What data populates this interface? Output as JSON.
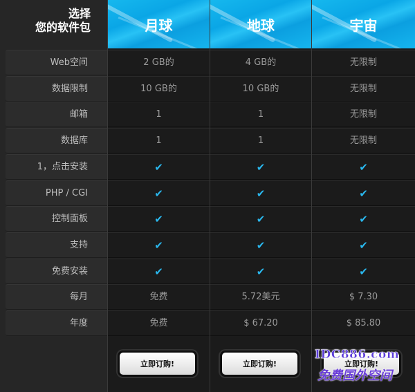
{
  "header": {
    "choose_line1": "选择",
    "choose_line2": "您的软件包",
    "plans": [
      "月球",
      "地球",
      "宇宙"
    ]
  },
  "rows": [
    {
      "label": "Web空间",
      "values": [
        "2 GB的",
        "4 GB的",
        "无限制"
      ]
    },
    {
      "label": "数据限制",
      "values": [
        "10 GB的",
        "10 GB的",
        "无限制"
      ]
    },
    {
      "label": "邮箱",
      "values": [
        "1",
        "1",
        "无限制"
      ]
    },
    {
      "label": "数据库",
      "values": [
        "1",
        "1",
        "无限制"
      ]
    },
    {
      "label": "1，点击安装",
      "values": [
        "✔",
        "✔",
        "✔"
      ]
    },
    {
      "label": "PHP / CGI",
      "values": [
        "✔",
        "✔",
        "✔"
      ]
    },
    {
      "label": "控制面板",
      "values": [
        "✔",
        "✔",
        "✔"
      ]
    },
    {
      "label": "支持",
      "values": [
        "✔",
        "✔",
        "✔"
      ]
    },
    {
      "label": "免费安装",
      "values": [
        "✔",
        "✔",
        "✔"
      ]
    },
    {
      "label": "每月",
      "values": [
        "免费",
        "5.72美元",
        "$ 7.30"
      ]
    },
    {
      "label": "年度",
      "values": [
        "免费",
        "$ 67.20",
        "$ 85.80"
      ]
    }
  ],
  "order_button_label": "立即订购!",
  "watermark": {
    "line1": "IDC886.com",
    "line2": "免费国外空间"
  },
  "colors": {
    "accent": "#16b8ee",
    "check": "#2ab8ee"
  }
}
